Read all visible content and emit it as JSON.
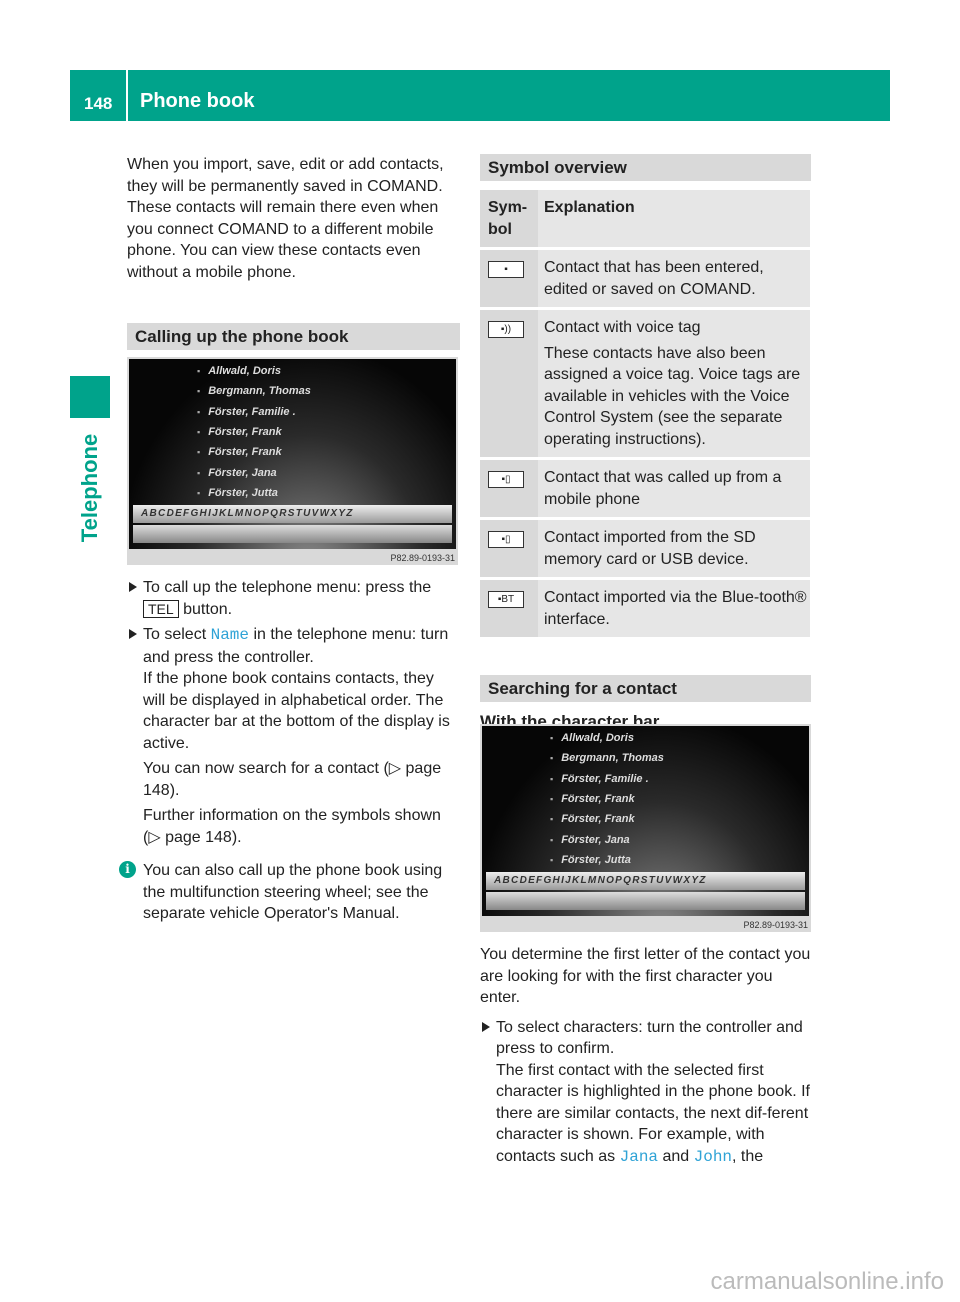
{
  "header": {
    "page_number": "148",
    "title": "Phone book"
  },
  "side_tab": "Telephone",
  "left": {
    "intro": "When you import, save, edit or add contacts, they will be permanently saved in COMAND. These contacts will remain there even when you connect COMAND to a different mobile phone. You can view these contacts even without a mobile phone.",
    "section": "Calling up the phone book",
    "step1_a": "To call up the telephone menu: press the",
    "step1_key": "TEL",
    "step1_b": " button.",
    "step2_a": "To select ",
    "step2_hl": "Name",
    "step2_b": " in the telephone menu: turn and press the controller.",
    "step2_c": "If the phone book contains contacts, they will be displayed in alphabetical order. The character bar at the bottom of the display is active.",
    "step2_d": "You can now search for a contact (▷ page 148).",
    "step2_e": "Further information on the symbols shown (▷ page 148).",
    "info": "You can also call up the phone book using the multifunction steering wheel; see the separate vehicle Operator's Manual."
  },
  "screen": {
    "contacts": [
      "Allwald, Doris",
      "Bergmann, Thomas",
      "Förster, Familie .",
      "Förster, Frank",
      "Förster, Frank",
      "Förster, Jana",
      "Förster, Jutta"
    ],
    "alphabet": "ABCDEFGHIJKLMNOPQRSTUVWXYZ",
    "ref": "P82.89-0193-31"
  },
  "right": {
    "section": "Symbol overview",
    "table_head": [
      "Sym-\nbol",
      "Explanation"
    ],
    "rows": [
      {
        "icon": "person-icon",
        "glyph": "▪",
        "text": "Contact that has been entered, edited or saved on COMAND."
      },
      {
        "icon": "person-voice-icon",
        "glyph": "▪))",
        "text": "Contact with voice tag",
        "extra": "These contacts have also been assigned a voice tag. Voice tags are available in vehicles with the Voice Control System (see the separate operating instructions)."
      },
      {
        "icon": "person-phone-icon",
        "glyph": "▪▯",
        "text": "Contact that was called up from a mobile phone"
      },
      {
        "icon": "person-sd-icon",
        "glyph": "▪▯",
        "text": "Contact imported from the SD memory card or USB device."
      },
      {
        "icon": "person-bluetooth-icon",
        "glyph": "▪BT",
        "text": "Contact imported via the Blue-tooth® interface."
      }
    ],
    "section2": "Searching for a contact",
    "sub": "With the character bar",
    "p1": "You determine the first letter of the contact you are looking for with the first character you enter.",
    "step_a": "To select characters: turn the controller and press to confirm.",
    "step_b": "The first contact with the selected first character is highlighted in the phone book. If there are similar contacts, the next dif-ferent character is shown. For example, with contacts such as ",
    "hl1": "Jana",
    "and": " and ",
    "hl2": "John",
    "tail": ", the"
  },
  "watermark": "carmanualsonline.info",
  "colors": {
    "accent": "#00a38b",
    "link": "#2fa3d6"
  }
}
